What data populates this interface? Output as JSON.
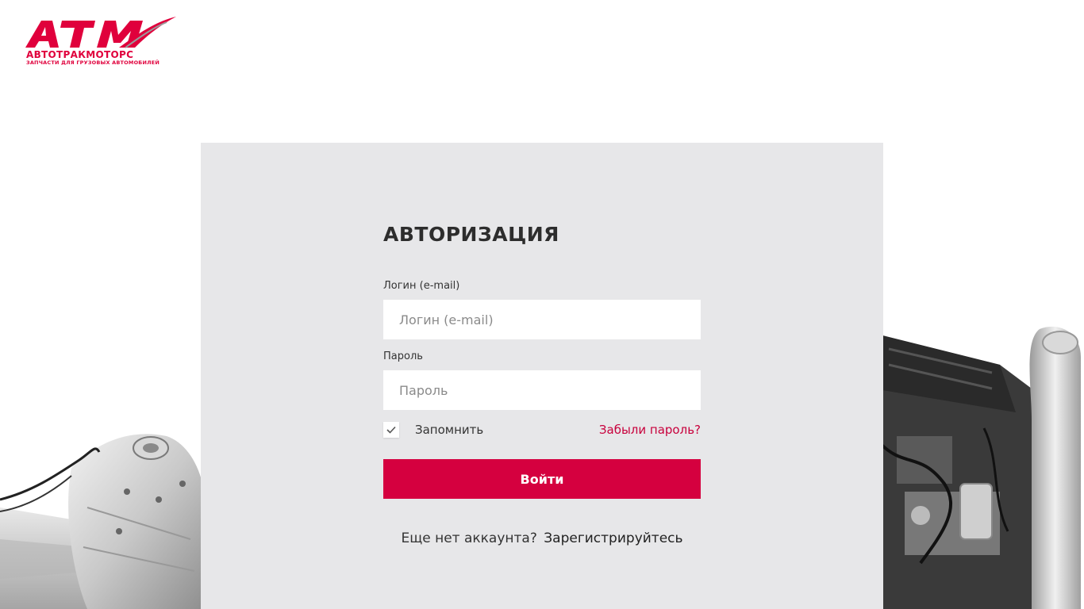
{
  "logo": {
    "mark": "ATM",
    "name": "АВТОТРАКМОТОРС",
    "tagline": "ЗАПЧАСТИ ДЛЯ ГРУЗОВЫХ АВТОМОБИЛЕЙ"
  },
  "auth": {
    "title": "АВТОРИЗАЦИЯ",
    "login_label": "Логин (e-mail)",
    "login_placeholder": "Логин (e-mail)",
    "login_value": "",
    "password_label": "Пароль",
    "password_placeholder": "Пароль",
    "password_value": "",
    "remember_label": "Запомнить",
    "remember_checked": true,
    "forgot_link": "Забыли пароль?",
    "submit_label": "Войти",
    "signup_prompt": "Еще нет аккаунта?",
    "signup_link": "Зарегистрируйтесь"
  },
  "colors": {
    "brand": "#d5003f",
    "card_bg": "#e7e7e9"
  },
  "icons": {
    "checkbox": "checkmark-icon"
  }
}
